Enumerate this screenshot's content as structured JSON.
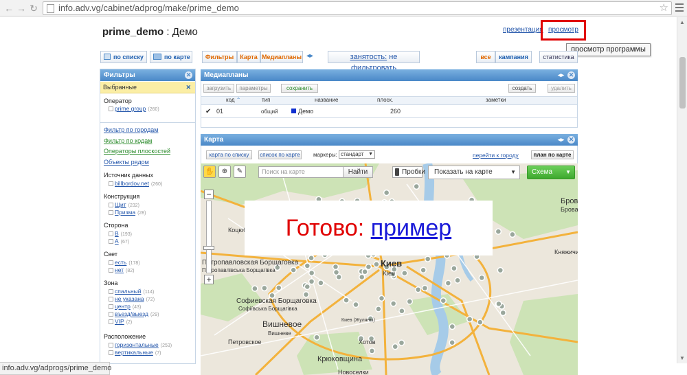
{
  "browser": {
    "url": "info.adv.vg/cabinet/adprog/make/prime_demo",
    "status_url": "info.adv.vg/adprogs/prime_demo"
  },
  "header": {
    "title_bold": "prime_demo",
    "title_rest": " : Демо",
    "presentation": "презентация",
    "preview": "просмотр",
    "tooltip": "просмотр программы"
  },
  "toolbar": {
    "by_list": "по списку",
    "by_map": "по карте",
    "filters": "Фильтры",
    "map": "Карта",
    "mediaplans": "Медиапланы",
    "busy": "занятость:",
    "no_filter": "не фильтровать",
    "all": "все",
    "campaign": "кампания",
    "statistics": "статистика"
  },
  "filters": {
    "title": "Фильтры",
    "selected": "Выбранные",
    "operator": {
      "title": "Оператор",
      "items": [
        {
          "label": "prime group",
          "count": "(260)"
        }
      ]
    },
    "links": [
      "Фильтр по городам",
      "Фильтр по кодам",
      "Операторы плоскостей",
      "Объекты рядом"
    ],
    "source": {
      "title": "Источник данных",
      "items": [
        {
          "label": "billbordov.net",
          "count": "(260)"
        }
      ]
    },
    "construction": {
      "title": "Конструкция",
      "items": [
        {
          "label": "Щит",
          "count": "(232)"
        },
        {
          "label": "Призма",
          "count": "(28)"
        }
      ]
    },
    "side": {
      "title": "Сторона",
      "items": [
        {
          "label": "B",
          "count": "(193)"
        },
        {
          "label": "A",
          "count": "(67)"
        }
      ]
    },
    "light": {
      "title": "Свет",
      "items": [
        {
          "label": "есть",
          "count": "(178)"
        },
        {
          "label": "нет",
          "count": "(82)"
        }
      ]
    },
    "zone": {
      "title": "Зона",
      "items": [
        {
          "label": "спальный",
          "count": "(114)"
        },
        {
          "label": "не указана",
          "count": "(72)"
        },
        {
          "label": "центр",
          "count": "(43)"
        },
        {
          "label": "въезд/выезд",
          "count": "(29)"
        },
        {
          "label": "VIP",
          "count": "(2)"
        }
      ]
    },
    "placement": {
      "title": "Расположение",
      "items": [
        {
          "label": "горизонтальные",
          "count": "(253)"
        },
        {
          "label": "вертикальные",
          "count": "(7)"
        }
      ]
    }
  },
  "mediaplans": {
    "title": "Медиапланы",
    "load": "загрузить",
    "params": "параметры",
    "save": "сохранить",
    "create": "создать",
    "delete": "удалить",
    "columns": [
      "код",
      "тип",
      "название",
      "плоск.",
      "заметки"
    ],
    "rows": [
      {
        "code": "01",
        "type": "общий",
        "name": "Демо",
        "count": "260",
        "notes": ""
      }
    ]
  },
  "mappanel": {
    "title": "Карта",
    "to_list": "карта по списку",
    "list_to_map": "список по карте",
    "markers_label": "маркеры:",
    "markers_value": "стандарт",
    "go_city": "перейти к городу",
    "plan_map": "план по карте",
    "search_placeholder": "Поиск на карте",
    "find": "Найти",
    "traffic": "Пробки",
    "show_on_map": "Показать на карте",
    "scheme": "Схема",
    "labels": [
      "Киев",
      "Kiev",
      "Вишневое",
      "Вишневе",
      "Софиевская Борщаговка",
      "Петропавловская Борщаговка",
      "Коцюбинское",
      "Бровары",
      "Бровари",
      "Княжичи",
      "Петровское",
      "Хотов",
      "Крюковщина",
      "Новоселки",
      "Софіївська Борщагівка",
      "Петропавлівська Борщагівка",
      "Киев (Жуляны)"
    ]
  },
  "overlay": {
    "text": "Готово: ",
    "link": "пример"
  },
  "colors": {
    "accent_orange": "#e06800",
    "link_blue": "#2255aa",
    "panel_blue": "#4a88c8",
    "preview_red": "#e00000",
    "overlay_red": "#e00000",
    "overlay_link": "#1a1ad8"
  }
}
